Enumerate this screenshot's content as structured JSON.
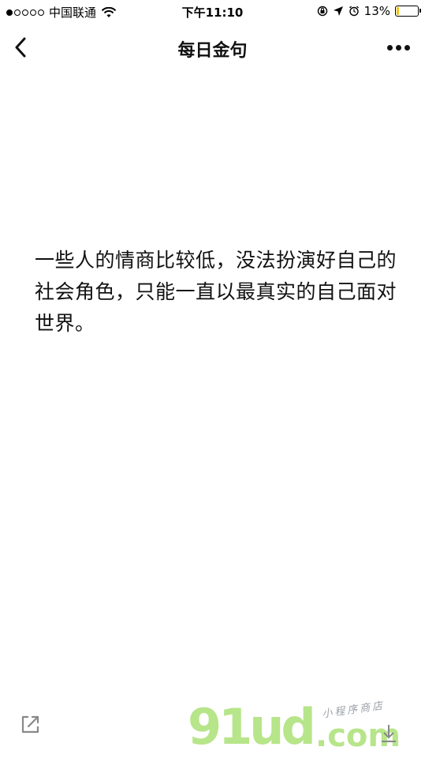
{
  "status_bar": {
    "carrier": "中国联通",
    "time": "下午11:10",
    "battery_percent": "13%",
    "battery_level": 0.13,
    "icons": [
      "signal-dots-icon",
      "wifi-icon",
      "rotation-lock-icon",
      "location-icon",
      "alarm-icon",
      "battery-icon"
    ]
  },
  "nav": {
    "title": "每日金句",
    "back_icon": "chevron-left-icon",
    "more_icon": "more-dots-icon"
  },
  "quote": {
    "text": "一些人的情商比较低，没法扮演好自己的社会角色，只能一直以最真实的自己面对世界。"
  },
  "footer": {
    "share_icon": "share-icon"
  },
  "watermark": {
    "logo": "91ud",
    "subtitle": "小程序商店",
    "suffix": ".com",
    "color": "#b7e58a"
  }
}
